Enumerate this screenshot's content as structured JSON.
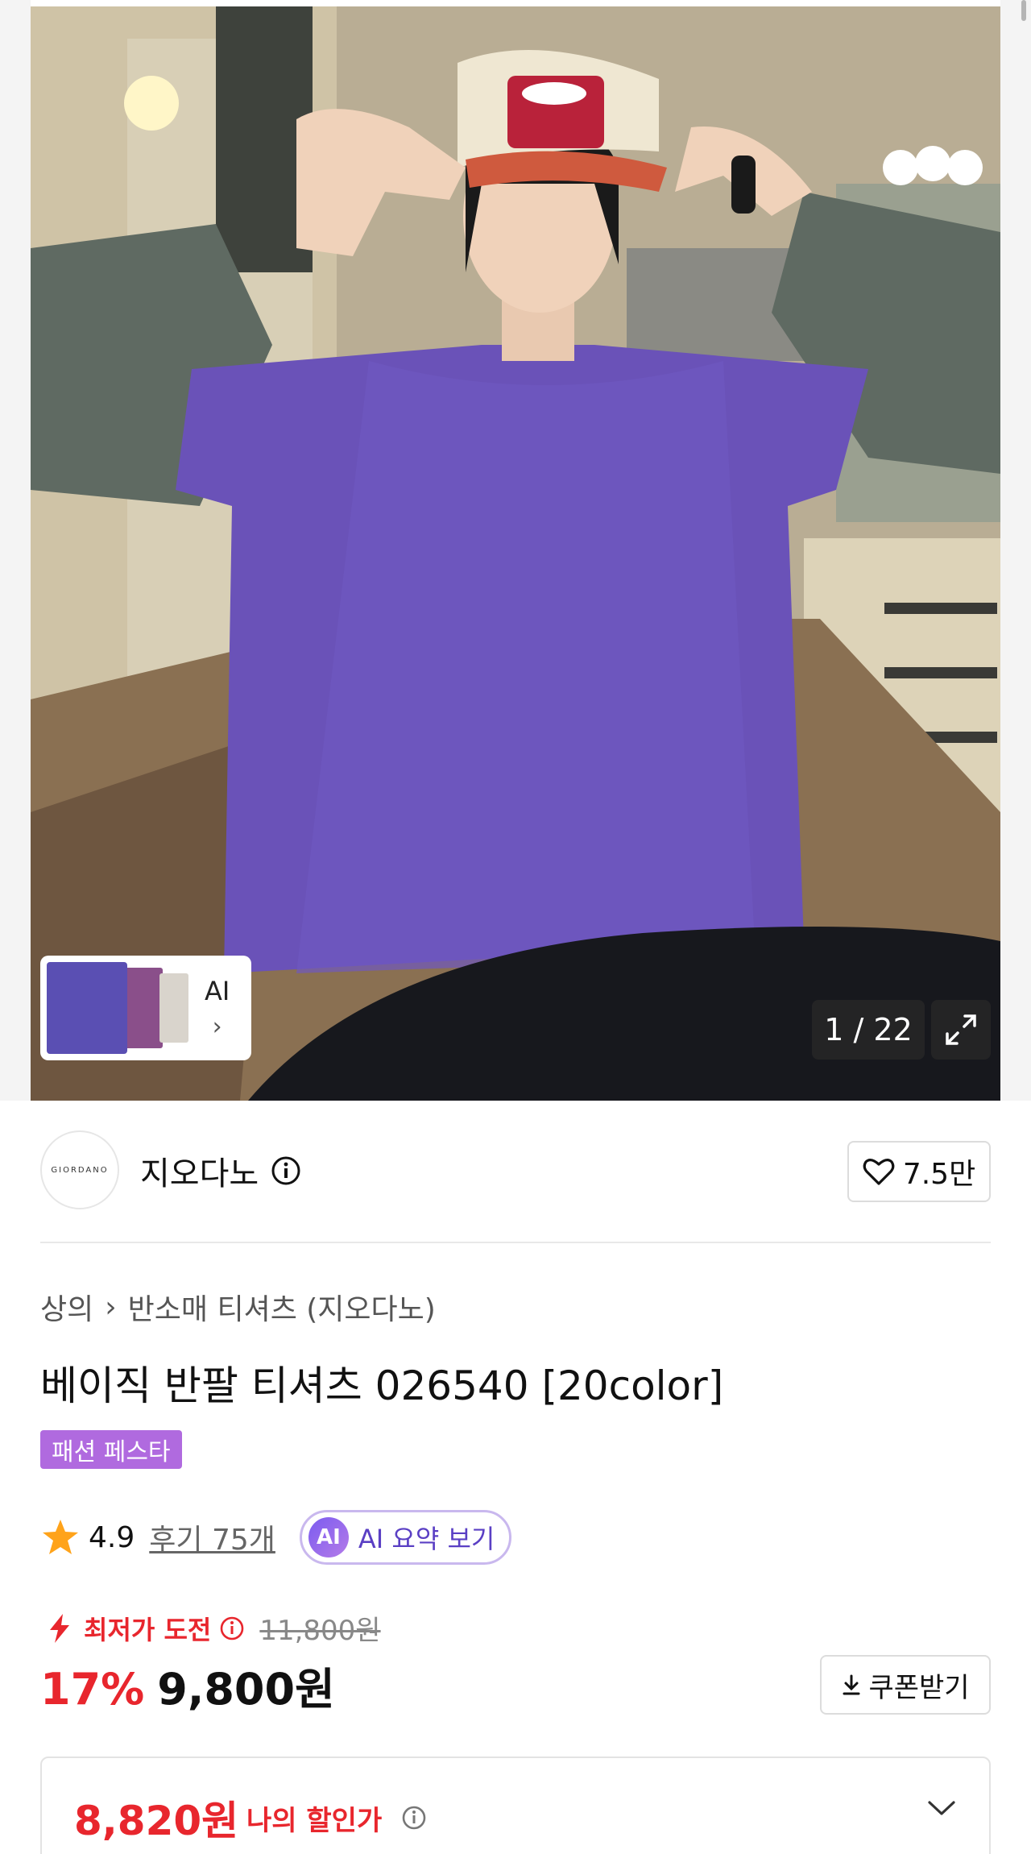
{
  "gallery": {
    "ai_label": "AI",
    "counter": "1 / 22"
  },
  "brand": {
    "logo_text": "GIORDANO",
    "name": "지오다노",
    "likes": "7.5만"
  },
  "product": {
    "breadcrumb": [
      "상의",
      "반소매 티셔츠 (지오다노)"
    ],
    "title": "베이직 반팔 티셔츠 026540 [20color]",
    "badge": "패션 페스타",
    "rating": "4.9",
    "reviews": "후기 75개",
    "ai_summary_icon": "AI",
    "ai_summary_label": "AI 요약 보기"
  },
  "pricing": {
    "lowest_label": "최저가 도전",
    "original_price": "11,800원",
    "discount": "17%",
    "price": "9,800원",
    "coupon_label": "쿠폰받기",
    "my_price": "8,820원",
    "my_price_label": "나의 할인가"
  },
  "colors": {
    "accent_red": "#e8262d",
    "festa_purple": "#b06adf",
    "ai_purple": "#5a3fc4"
  }
}
